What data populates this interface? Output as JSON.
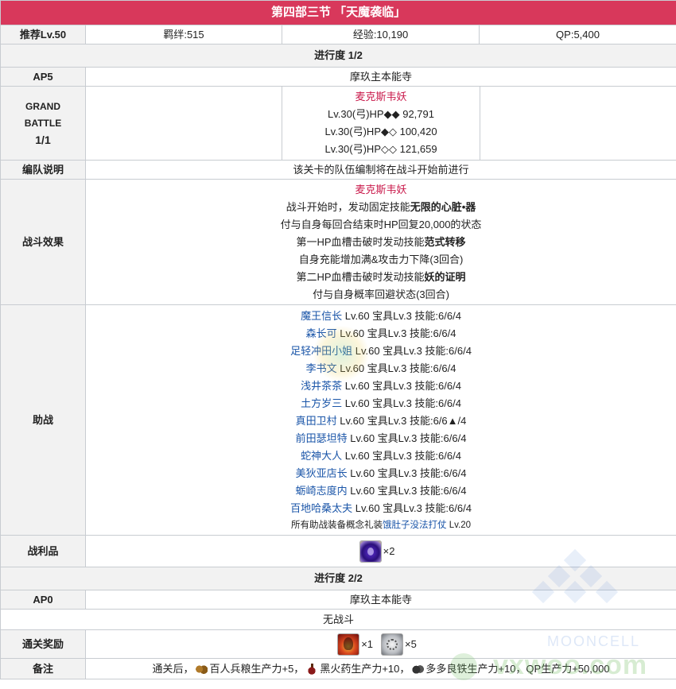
{
  "header": {
    "title": "第四部三节 「天魔袭临」"
  },
  "info": {
    "recommend": "推荐Lv.50",
    "bond": "羁绊:515",
    "exp": "经验:10,190",
    "qp": "QP:5,400"
  },
  "progress1": {
    "label": "进行度 1/2",
    "ap_label": "AP5",
    "location": "摩玖主本能寺",
    "battle_label_1": "GRAND",
    "battle_label_2": "BATTLE",
    "battle_label_3": "1/1",
    "enemy": {
      "name": "麦克斯韦妖",
      "lines": [
        "Lv.30(弓)HP◆◆ 92,791",
        "Lv.30(弓)HP◆◇ 100,420",
        "Lv.30(弓)HP◇◇ 121,659"
      ]
    },
    "formation_label": "编队说明",
    "formation_text": "该关卡的队伍编制将在战斗开始前进行",
    "effects_label": "战斗效果",
    "effects": {
      "name": "麦克斯韦妖",
      "l1a": "战斗开始时，发动固定技能",
      "l1b": "无限的心脏•器",
      "l2": "付与自身每回合结束时HP回复20,000的状态",
      "l3a": "第一HP血槽击破时发动技能",
      "l3b": "范式转移",
      "l4": "自身充能增加满&攻击力下降(3回合)",
      "l5a": "第二HP血槽击破时发动技能",
      "l5b": "妖的证明",
      "l6": "付与自身概率回避状态(3回合)"
    },
    "support_label": "助战",
    "supports": [
      {
        "name": "魔王信长",
        "stats": " Lv.60 宝具Lv.3 技能:6/6/4"
      },
      {
        "name": "森长可",
        "stats": " Lv.60 宝具Lv.3 技能:6/6/4"
      },
      {
        "name": "足轻冲田小姐",
        "stats": " Lv.60 宝具Lv.3 技能:6/6/4"
      },
      {
        "name": "李书文",
        "stats": " Lv.60 宝具Lv.3 技能:6/6/4"
      },
      {
        "name": "浅井茶茶",
        "stats": " Lv.60 宝具Lv.3 技能:6/6/4"
      },
      {
        "name": "土方岁三",
        "stats": " Lv.60 宝具Lv.3 技能:6/6/4"
      },
      {
        "name": "真田卫村",
        "stats": " Lv.60 宝具Lv.3 技能:6/6▲/4"
      },
      {
        "name": "前田瑟坦特",
        "stats": " Lv.60 宝具Lv.3 技能:6/6/4"
      },
      {
        "name": "蛇神大人",
        "stats": " Lv.60 宝具Lv.3 技能:6/6/4"
      },
      {
        "name": "美狄亚店长",
        "stats": " Lv.60 宝具Lv.3 技能:6/6/4"
      },
      {
        "name": "蛎崎志度内",
        "stats": " Lv.60 宝具Lv.3 技能:6/6/4"
      },
      {
        "name": "百地哈桑太夫",
        "stats": " Lv.60 宝具Lv.3 技能:6/6/4"
      }
    ],
    "support_ce_pre": "所有助战装备概念礼装",
    "support_ce_name": "饿肚子没法打仗",
    "support_ce_post": " Lv.20",
    "drops_label": "战利品",
    "drop_count": "×2"
  },
  "progress2": {
    "label": "进行度 2/2",
    "ap_label": "AP0",
    "location": "摩玖主本能寺",
    "no_battle": "无战斗",
    "reward_label": "通关奖励",
    "reward1_count": "×1",
    "reward2_count": "×5",
    "notes_label": "备注",
    "notes_a": "通关后，",
    "notes_b": "百人兵粮生产力+5，",
    "notes_c": "黑火药生产力+10，",
    "notes_d": "多多良铁生产力+10，QP生产力+50,000"
  },
  "watermark": {
    "site": "MOONCELL",
    "url": "vxwoo.com"
  }
}
